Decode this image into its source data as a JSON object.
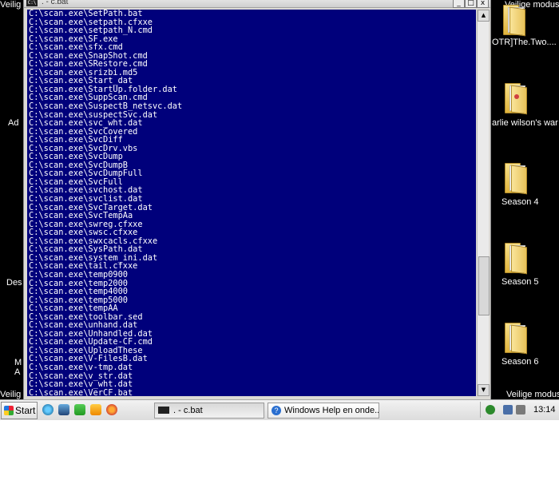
{
  "window": {
    "title": ". - c.bat",
    "icon_text": "C:\\",
    "buttons": {
      "minimize": "_",
      "maximize": "□",
      "close": "x"
    }
  },
  "console": {
    "background": "#00007b",
    "lines": [
      "C:\\scan.exe\\SetPath.bat",
      "C:\\scan.exe\\setpath.cfxxe",
      "C:\\scan.exe\\setpath_N.cmd",
      "C:\\scan.exe\\SF.exe",
      "C:\\scan.exe\\sfx.cmd",
      "C:\\scan.exe\\SnapShot.cmd",
      "C:\\scan.exe\\SRestore.cmd",
      "C:\\scan.exe\\srizbi.md5",
      "C:\\scan.exe\\Start_dat",
      "C:\\scan.exe\\StartUp.folder.dat",
      "C:\\scan.exe\\SuppScan.cmd",
      "C:\\scan.exe\\SuspectB_netsvc.dat",
      "C:\\scan.exe\\suspectSvc.dat",
      "C:\\scan.exe\\svc_wht.dat",
      "C:\\scan.exe\\SvcCovered",
      "C:\\scan.exe\\SvcDiff",
      "C:\\scan.exe\\SvcDrv.vbs",
      "C:\\scan.exe\\SvcDump",
      "C:\\scan.exe\\SvcDumpB",
      "C:\\scan.exe\\SvcDumpFull",
      "C:\\scan.exe\\SvcFull",
      "C:\\scan.exe\\svchost.dat",
      "C:\\scan.exe\\svclist.dat",
      "C:\\scan.exe\\SvcTarget.dat",
      "C:\\scan.exe\\SvcTempAa",
      "C:\\scan.exe\\swreg.cfxxe",
      "C:\\scan.exe\\swsc.cfxxe",
      "C:\\scan.exe\\swxcacls.cfxxe",
      "C:\\scan.exe\\SysPath.dat",
      "C:\\scan.exe\\system_ini.dat",
      "C:\\scan.exe\\tail.cfxxe",
      "C:\\scan.exe\\temp0900",
      "C:\\scan.exe\\temp2000",
      "C:\\scan.exe\\temp4000",
      "C:\\scan.exe\\temp5000",
      "C:\\scan.exe\\tempAA",
      "C:\\scan.exe\\toolbar.sed",
      "C:\\scan.exe\\unhand.dat",
      "C:\\scan.exe\\Unhandled.dat",
      "C:\\scan.exe\\Update-CF.cmd",
      "C:\\scan.exe\\UploadThese",
      "C:\\scan.exe\\V-FilesB.dat",
      "C:\\scan.exe\\v-tmp.dat",
      "C:\\scan.exe\\v_str.dat",
      "C:\\scan.exe\\v_wht.dat",
      "C:\\scan.exe\\VerCF.bat"
    ]
  },
  "scrollbar": {
    "up_arrow": "▲",
    "down_arrow": "▼",
    "thumb_position": 0.77
  },
  "desktop": {
    "right_folders": [
      {
        "label": "Veilige modus",
        "icon": "folder-icon"
      },
      {
        "label": "OTR]The.Two....",
        "icon": "folder-icon"
      },
      {
        "label": "arlie wilson's war",
        "icon": "folder-icon"
      },
      {
        "label": "Season 4",
        "icon": "folder-icon"
      },
      {
        "label": "Season 5",
        "icon": "folder-icon"
      },
      {
        "label": "Season 6",
        "icon": "folder-icon"
      },
      {
        "label": "Veilige modus",
        "icon": "folder-icon"
      }
    ],
    "left_fragments": [
      "Veilig",
      "Ad",
      "Des",
      "M",
      "A",
      "Veilig"
    ]
  },
  "taskbar": {
    "start_label": "Start",
    "quick_launch": [
      "ie-icon",
      "desktop-icon",
      "messenger-icon",
      "media-icon",
      "firefox-icon"
    ],
    "tasks": [
      {
        "label": ". - c.bat",
        "active": true,
        "icon": "console-icon"
      },
      {
        "label": "Windows Help en onde...",
        "active": false,
        "icon": "help-icon"
      }
    ],
    "clock": "13:14",
    "tray_icons": [
      "security-icon",
      "network-icon",
      "volume-icon"
    ]
  },
  "colors": {
    "console_bg": "#00007b",
    "console_fg": "#ffffff",
    "desktop_bg": "#000000",
    "taskbar_bg": "#e6e6e6"
  }
}
